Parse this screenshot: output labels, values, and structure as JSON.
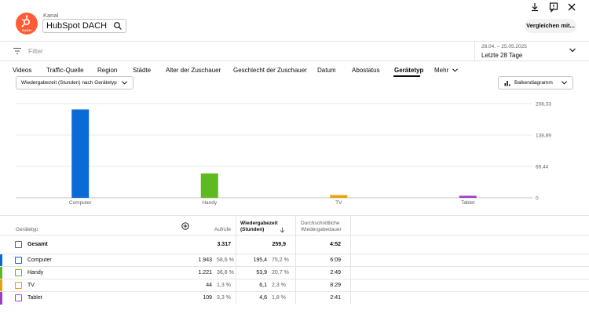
{
  "header": {
    "channel_label": "Kanal",
    "channel_name": "HubSpot DACH",
    "logo_text": "DACH",
    "compare_button": "Vergleichen mit...",
    "brand_color": "#ff5c35"
  },
  "filter": {
    "placeholder": "Filter",
    "date_range": "28.04. – 25.05.2025",
    "date_label": "Letzte 28 Tage"
  },
  "tabs": [
    {
      "label": "Videos"
    },
    {
      "label": "Traffic-Quelle"
    },
    {
      "label": "Region"
    },
    {
      "label": "Städte"
    },
    {
      "label": "Alter der Zuschauer"
    },
    {
      "label": "Geschlecht der Zuschauer"
    },
    {
      "label": "Datum"
    },
    {
      "label": "Abostatus"
    },
    {
      "label": "Gerätetyp",
      "active": true
    },
    {
      "label": "Mehr"
    }
  ],
  "chart_controls": {
    "metric": "Wiedergabezeit (Stunden) nach Gerätetyp",
    "chart_type": "Balkendiagramm"
  },
  "chart_data": {
    "type": "bar",
    "categories": [
      "Computer",
      "Handy",
      "TV",
      "Tablet"
    ],
    "values": [
      195.4,
      53.9,
      6.1,
      4.6
    ],
    "colors": [
      "#0b6bd6",
      "#5fb921",
      "#e8a20c",
      "#9c3fc7"
    ],
    "y_ticks": [
      "208,33",
      "138,89",
      "69,44",
      "0"
    ],
    "ylim": [
      0,
      208.33
    ],
    "grid": true
  },
  "table": {
    "headers": {
      "device": "Gerätetyp",
      "views": "Aufrufe",
      "watch_time": "Wiedergabezeit (Stunden)",
      "avg_duration": "Durchschnittliche Wiedergabedauer"
    },
    "total": {
      "label": "Gesamt",
      "views": "3.317",
      "watch_time": "259,9",
      "avg_duration": "4:52"
    },
    "rows": [
      {
        "label": "Computer",
        "views": "1.943",
        "views_pct": "58,6 %",
        "watch_time": "195,4",
        "watch_pct": "75,2 %",
        "avg_duration": "6:09",
        "color": "#0b6bd6"
      },
      {
        "label": "Handy",
        "views": "1.221",
        "views_pct": "36,8 %",
        "watch_time": "53,9",
        "watch_pct": "20,7 %",
        "avg_duration": "2:49",
        "color": "#5fb921"
      },
      {
        "label": "TV",
        "views": "44",
        "views_pct": "1,3 %",
        "watch_time": "6,1",
        "watch_pct": "2,3 %",
        "avg_duration": "8:29",
        "color": "#e8a20c"
      },
      {
        "label": "Tablet",
        "views": "109",
        "views_pct": "3,3 %",
        "watch_time": "4,6",
        "watch_pct": "1,8 %",
        "avg_duration": "2:41",
        "color": "#9c3fc7"
      }
    ]
  }
}
